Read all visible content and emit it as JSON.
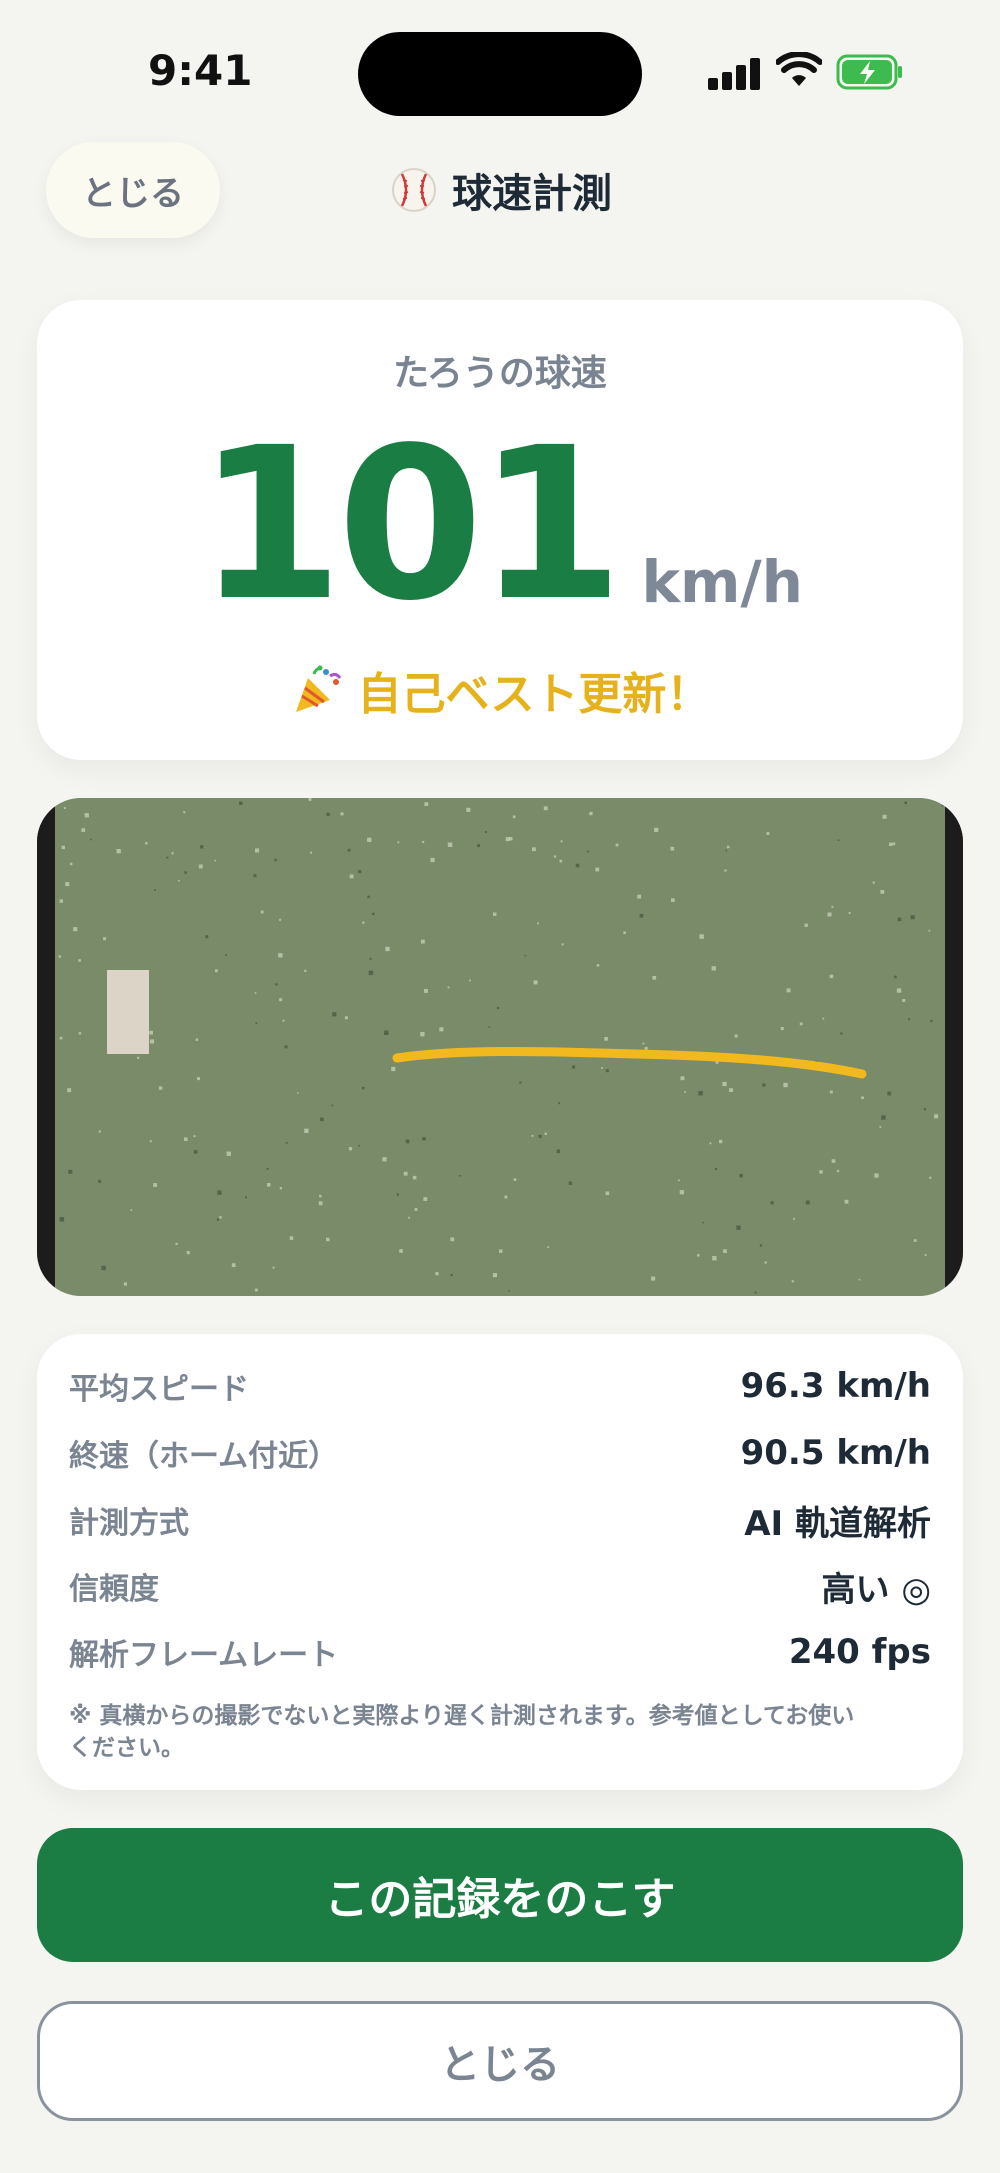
{
  "status_bar": {
    "time": "9:41"
  },
  "header": {
    "close_label": "とじる",
    "title": "球速計測",
    "title_icon": "baseball-icon"
  },
  "speed_card": {
    "label": "たろうの球速",
    "value": "101",
    "unit": "km/h",
    "best_badge": "自己ベスト更新！",
    "best_icon": "party-popper-icon",
    "accent_color": "#1a7d43",
    "badge_color": "#e6b21c"
  },
  "video": {
    "background_color": "#7a8b6a",
    "trajectory_color": "#f2b91e"
  },
  "stats": [
    {
      "label": "平均スピード",
      "value": "96.3 km/h"
    },
    {
      "label": "終速（ホーム付近）",
      "value": "90.5 km/h"
    },
    {
      "label": "計測方式",
      "value": "AI 軌道解析"
    },
    {
      "label": "信頼度",
      "value": "高い ◎"
    },
    {
      "label": "解析フレームレート",
      "value": "240 fps"
    }
  ],
  "note": "※ 真横からの撮影でないと実際より遅く計測されます。参考値としてお使いください。",
  "buttons": {
    "save_label": "この記録をのこす",
    "close_label": "とじる"
  }
}
